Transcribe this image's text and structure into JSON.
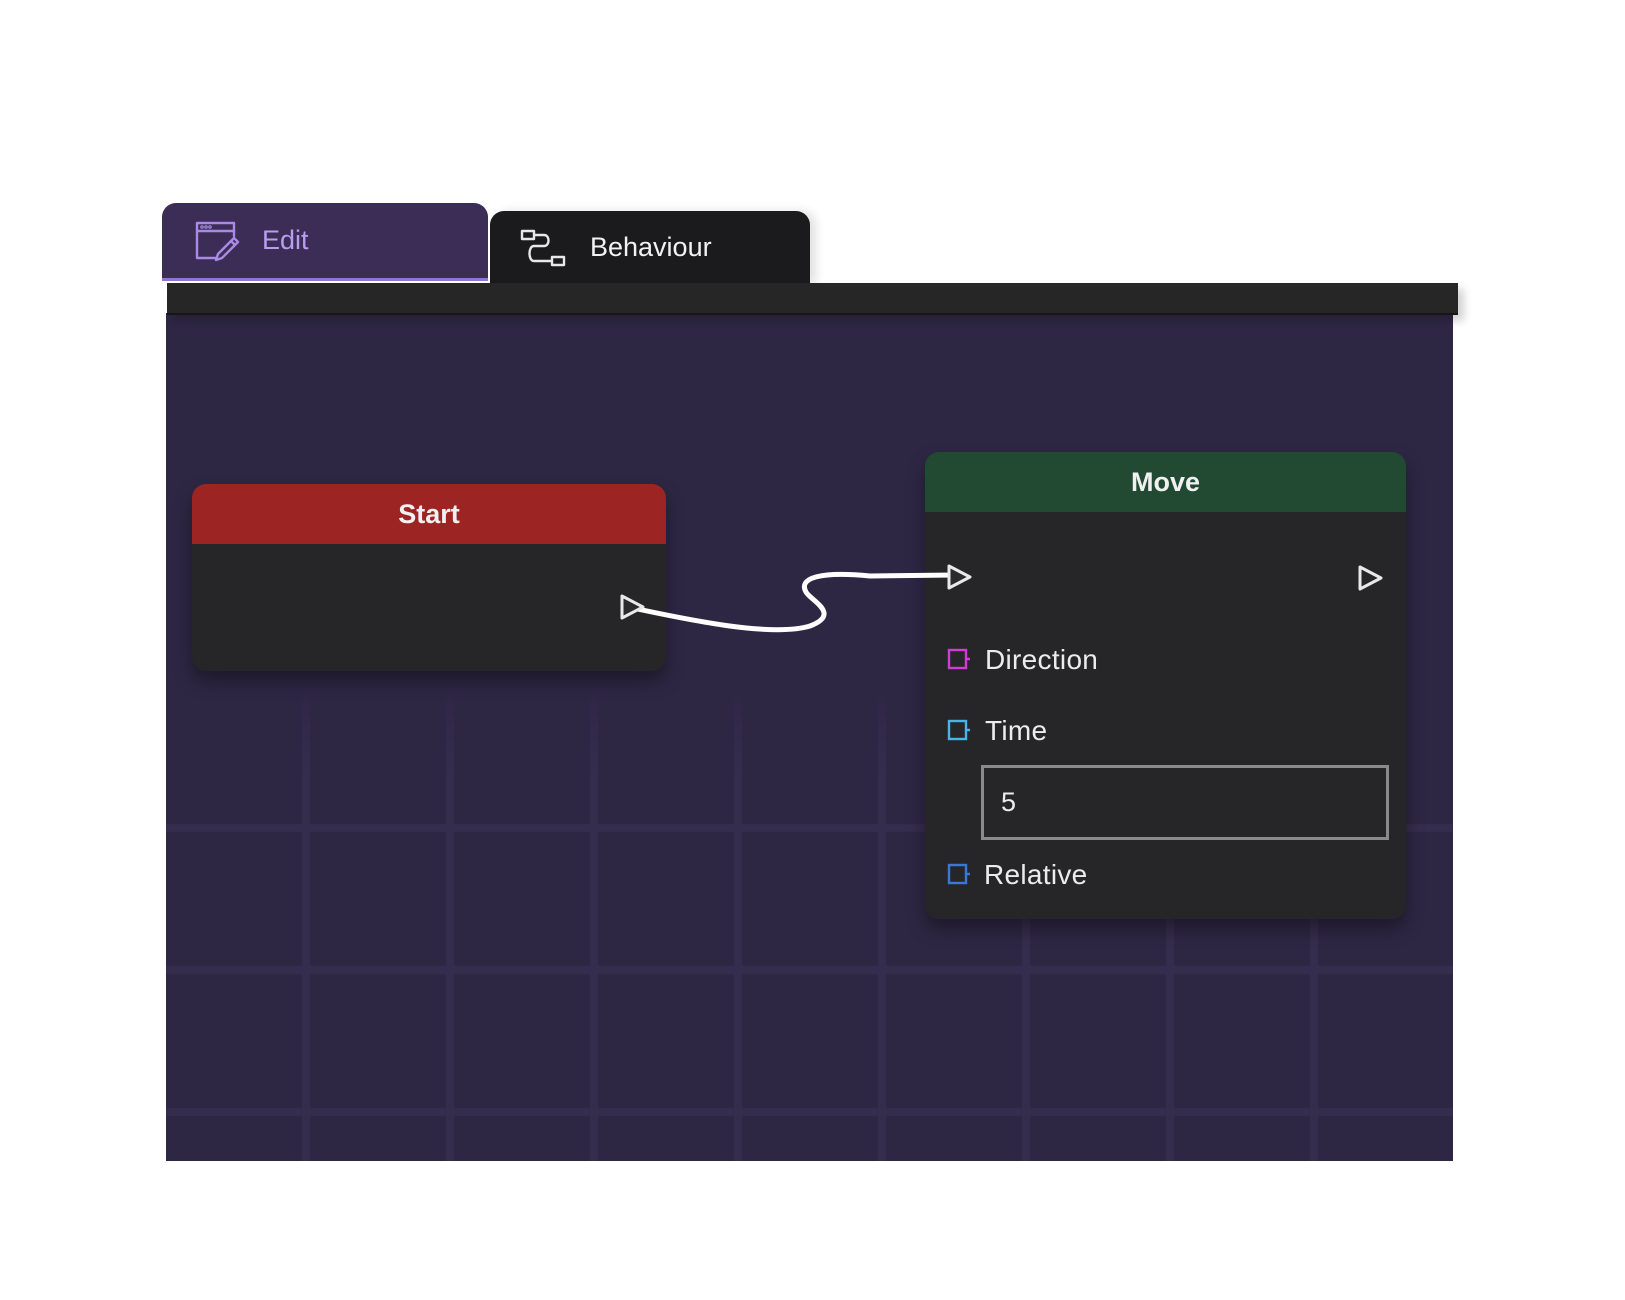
{
  "tabs": {
    "edit": {
      "label": "Edit",
      "icon": "pencil-window-icon"
    },
    "behaviour": {
      "label": "Behaviour",
      "icon": "node-flow-icon"
    }
  },
  "nodes": {
    "start": {
      "title": "Start",
      "color": "#9c2422"
    },
    "move": {
      "title": "Move",
      "color": "#224a33",
      "ports": {
        "direction": {
          "label": "Direction",
          "color": "#d23bd6"
        },
        "time": {
          "label": "Time",
          "color": "#4ab3e8",
          "value": "5"
        },
        "relative": {
          "label": "Relative",
          "color": "#3a78d8"
        }
      }
    }
  },
  "colors": {
    "canvas_bg": "#2e2744",
    "node_body": "#262628",
    "edit_tab": "#3b2d55",
    "edit_accent": "#b99df0"
  }
}
